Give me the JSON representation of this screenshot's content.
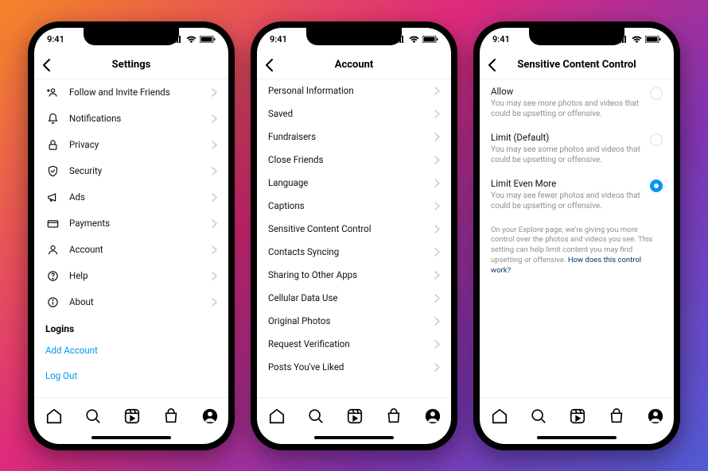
{
  "status": {
    "time": "9:41"
  },
  "phone1": {
    "title": "Settings",
    "items": [
      {
        "label": "Follow and Invite Friends",
        "icon": "add-friend-icon"
      },
      {
        "label": "Notifications",
        "icon": "bell-icon"
      },
      {
        "label": "Privacy",
        "icon": "lock-icon"
      },
      {
        "label": "Security",
        "icon": "shield-icon"
      },
      {
        "label": "Ads",
        "icon": "megaphone-icon"
      },
      {
        "label": "Payments",
        "icon": "card-icon"
      },
      {
        "label": "Account",
        "icon": "user-icon"
      },
      {
        "label": "Help",
        "icon": "help-icon"
      },
      {
        "label": "About",
        "icon": "info-icon"
      }
    ],
    "logins_header": "Logins",
    "add_account": "Add Account",
    "log_out": "Log Out"
  },
  "phone2": {
    "title": "Account",
    "items": [
      "Personal Information",
      "Saved",
      "Fundraisers",
      "Close Friends",
      "Language",
      "Captions",
      "Sensitive Content Control",
      "Contacts Syncing",
      "Sharing to Other Apps",
      "Cellular Data Use",
      "Original Photos",
      "Request Verification",
      "Posts You've Liked"
    ]
  },
  "phone3": {
    "title": "Sensitive Content Control",
    "options": [
      {
        "title": "Allow",
        "desc": "You may see more photos and videos that could be upsetting or offensive.",
        "selected": false
      },
      {
        "title": "Limit (Default)",
        "desc": "You may see some photos and videos that could be upsetting or offensive.",
        "selected": false
      },
      {
        "title": "Limit Even More",
        "desc": "You may see fewer photos and videos that could be upsetting or offensive.",
        "selected": true
      }
    ],
    "footnote_text": "On your Explore page, we're giving you more control over the photos and videos you see. This setting can help limit content you may find upsetting or offensive. ",
    "footnote_link": "How does this control work?"
  }
}
